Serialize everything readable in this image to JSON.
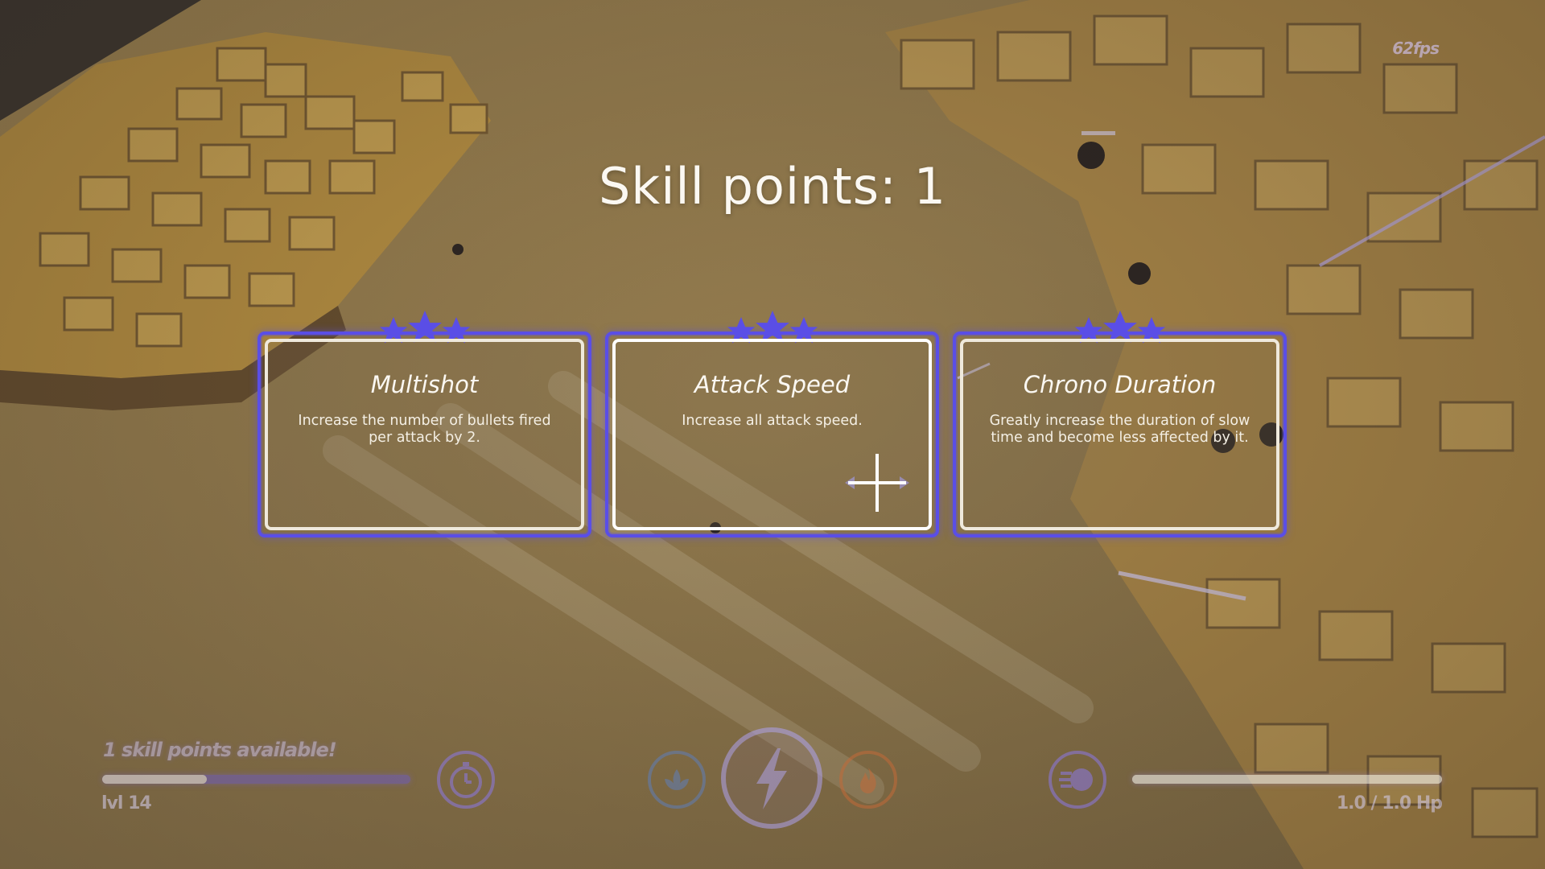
{
  "hud": {
    "fps": "62fps",
    "skill_points_available": "1 skill points available!",
    "level": "lvl 14",
    "xp_progress": 0.34,
    "hp": "1.0 / 1.0 Hp",
    "hp_fraction": 1.0
  },
  "overlay": {
    "title": "Skill points: 1"
  },
  "skills": [
    {
      "name": "Multishot",
      "description": "Increase the number of bullets fired per attack by 2.",
      "stars": 3
    },
    {
      "name": "Attack Speed",
      "description": "Increase all attack speed.",
      "stars": 3
    },
    {
      "name": "Chrono Duration",
      "description": "Greatly increase the duration of slow time and become less affected by it.",
      "stars": 3
    }
  ],
  "abilities": [
    {
      "icon": "stopwatch-icon"
    },
    {
      "icon": "lotus-icon"
    },
    {
      "icon": "lightning-icon"
    },
    {
      "icon": "flame-icon"
    },
    {
      "icon": "dash-icon"
    }
  ],
  "colors": {
    "accent": "#5a4ee6",
    "card_border": "#efe9dc",
    "terrain": "#c9a24f",
    "hud_glow": "#8c78e6"
  }
}
